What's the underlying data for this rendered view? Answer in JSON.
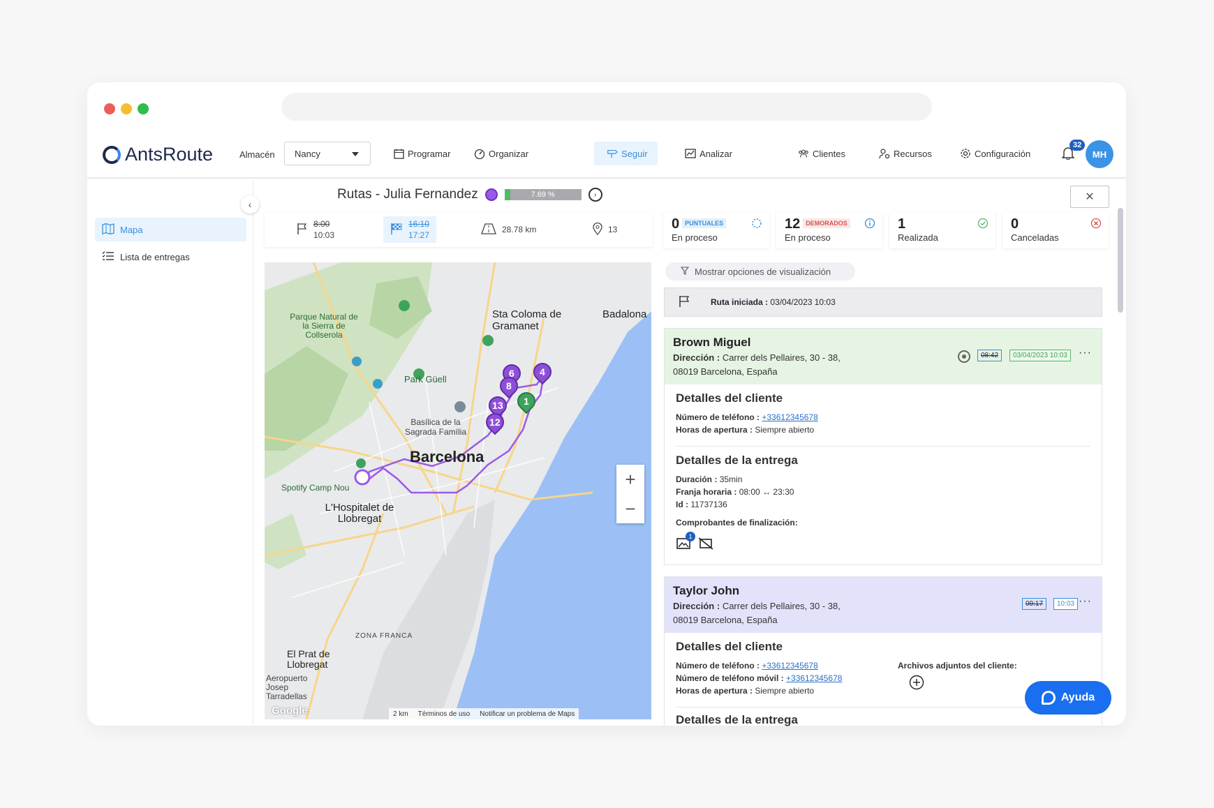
{
  "window": {
    "dots": [
      "#ec5f57",
      "#f6bd30",
      "#2ebe4a"
    ]
  },
  "header": {
    "logo": "AntsRoute",
    "store_label": "Almacén",
    "store_value": "Nancy",
    "nav": [
      {
        "label": "Programar",
        "icon": "calendar-icon"
      },
      {
        "label": "Organizar",
        "icon": "gauge-icon"
      },
      {
        "label": "Seguir",
        "icon": "signpost-icon"
      },
      {
        "label": "Analizar",
        "icon": "chart-icon"
      }
    ],
    "right_nav": [
      {
        "label": "Clientes",
        "icon": "users-icon"
      },
      {
        "label": "Recursos",
        "icon": "user-gear-icon"
      },
      {
        "label": "Configuración",
        "icon": "gear-icon"
      }
    ],
    "notifications": "32",
    "avatar": "MH"
  },
  "sidebar": {
    "items": [
      {
        "label": "Mapa",
        "icon": "map-icon"
      },
      {
        "label": "Lista de entregas",
        "icon": "list-icon"
      }
    ]
  },
  "route": {
    "title": "Rutas - Julia Fernandez",
    "progress_text": "7.69 %",
    "progress_value": 7.69,
    "color": "#9b59e8"
  },
  "stats": {
    "start_planned": "8:00",
    "start_actual": "10:03",
    "end_planned": "16:10",
    "end_actual": "17:27",
    "distance": "28.78 km",
    "stops": "13"
  },
  "counters": [
    {
      "num": "0",
      "tag": "PUNTUALES",
      "label": "En proceso",
      "tag_color": "#3a8ed8",
      "tag_bg": "#e3f0fb"
    },
    {
      "num": "12",
      "tag": "DEMORADOS",
      "label": "En proceso",
      "tag_color": "#d9534f",
      "tag_bg": "#fbe7e6"
    },
    {
      "num": "1",
      "tag": "",
      "label": "Realizada"
    },
    {
      "num": "0",
      "tag": "",
      "label": "Canceladas"
    }
  ],
  "map": {
    "labels": {
      "barcelona": "Barcelona",
      "hospitalet": "L'Hospitalet de Llobregat",
      "santa_coloma": "Sta Coloma de Gramanet",
      "badalona": "Badalona",
      "prat": "El Prat de Llobregat",
      "park_guell": "Park Güell",
      "sagrada": "Basílica de la Sagrada Família",
      "zona_franca": "ZONA FRANCA",
      "collserola": "Parque Natural de la Sierra de Collserola",
      "spotify": "Spotify Camp Nou",
      "aeropuerto": "Aeropuerto Josep Tarradellas"
    },
    "markers": [
      "6",
      "4",
      "8",
      "13",
      "1",
      "12"
    ],
    "zoom_in": "+",
    "zoom_out": "−",
    "scale": "2 km",
    "terms": "Términos de uso",
    "report": "Notificar un problema de Maps",
    "google": "Google"
  },
  "panel": {
    "filter": "Mostrar opciones de visualización",
    "route_started_label": "Ruta iniciada :",
    "route_started_value": "03/04/2023 10:03"
  },
  "cards": [
    {
      "name": "Brown Miguel",
      "addr_label": "Dirección :",
      "addr_line1": "Carrer dels Pellaires, 30 - 38,",
      "addr_line2": "08019 Barcelona, España",
      "time_old": "08:42",
      "time_new": "03/04/2023 10:03",
      "client_title": "Detalles del cliente",
      "phone_label": "Número de teléfono :",
      "phone": "+33612345678",
      "hours_label": "Horas de apertura :",
      "hours": "Siempre abierto",
      "delivery_title": "Detalles de la entrega",
      "duration_label": "Duración :",
      "duration": "35min",
      "slot_label": "Franja horaria :",
      "slot": "08:00 ↔ 23:30",
      "id_label": "Id :",
      "id": "11737136",
      "proofs_label": "Comprobantes de finalización:",
      "proof_count": "1"
    },
    {
      "name": "Taylor John",
      "addr_label": "Dirección :",
      "addr_line1": "Carrer dels Pellaires, 30 - 38,",
      "addr_line2": "08019 Barcelona, España",
      "time_old": "09:17",
      "time_new": "10:03",
      "client_title": "Detalles del cliente",
      "phone_label": "Número de teléfono :",
      "phone": "+33612345678",
      "mobile_label": "Número de teléfono móvil :",
      "mobile": "+33612345678",
      "hours_label": "Horas de apertura :",
      "hours": "Siempre abierto",
      "attachments_label": "Archivos adjuntos del cliente:",
      "delivery_title": "Detalles de la entrega"
    }
  ],
  "help": "Ayuda"
}
